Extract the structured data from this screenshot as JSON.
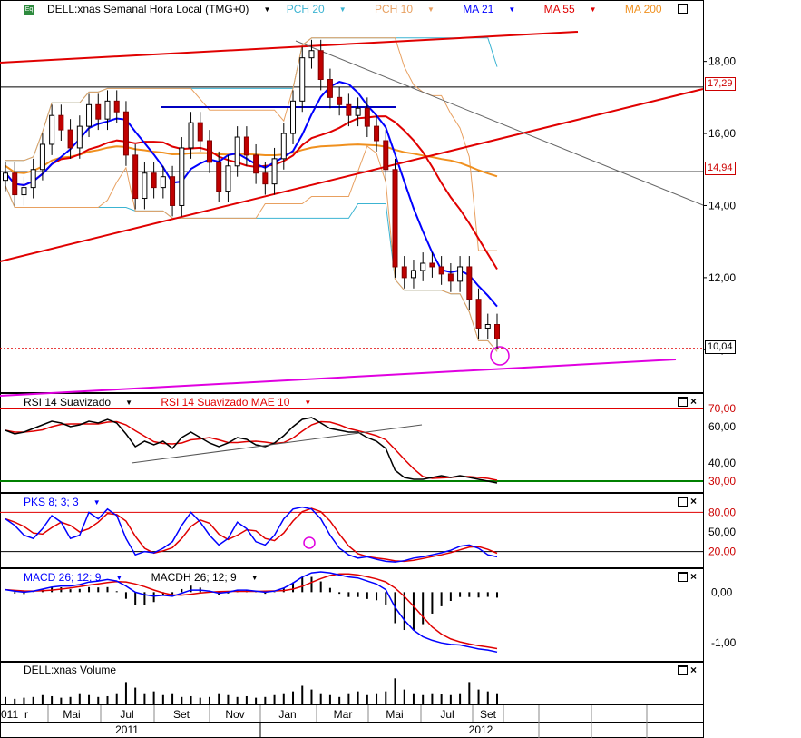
{
  "panels": {
    "price": {
      "title": "DELL:xnas Semanal Hora Local (TMG+0)",
      "indicators": [
        {
          "label": "PCH 20",
          "color": "#3cb4d2"
        },
        {
          "label": "PCH 10",
          "color": "#e8a060"
        },
        {
          "label": "MA 21",
          "color": "#0000ff"
        },
        {
          "label": "MA 55",
          "color": "#e00000"
        },
        {
          "label": "MA 200",
          "color": "#f0901e"
        }
      ]
    },
    "rsi": {
      "labels": [
        {
          "label": "RSI 14 Suavizado",
          "color": "#000000"
        },
        {
          "label": "RSI 14 Suavizado MAE 10",
          "color": "#e00000"
        }
      ]
    },
    "pks": {
      "labels": [
        {
          "label": "PKS 8; 3; 3",
          "color": "#0000ff"
        }
      ]
    },
    "macd": {
      "labels": [
        {
          "label": "MACD 26; 12; 9",
          "color": "#0000ff"
        },
        {
          "label": "MACDH 26; 12; 9",
          "color": "#000000"
        }
      ]
    },
    "volume": {
      "labels": [
        {
          "label": "DELL:xnas Volume",
          "color": "#000000"
        }
      ]
    }
  },
  "icons": {
    "eq": "Eq"
  },
  "x_axis": {
    "months": [
      "r",
      "Mai",
      "Jul",
      "Set",
      "Nov",
      "Jan",
      "Mar",
      "Mai",
      "Jul",
      "Set"
    ],
    "years": [
      "2011",
      "2012"
    ],
    "first_year_stub": "011"
  },
  "price_axis": {
    "ticks": [
      "18,00",
      "16,00",
      "14,00",
      "12,00",
      "10,00"
    ]
  },
  "price_tags": {
    "upper": "17,29",
    "middle": "14,94",
    "current": "10,04"
  },
  "rsi_axis": {
    "ticks": [
      "70,00",
      "60,00",
      "40,00",
      "30,00"
    ]
  },
  "pks_axis": {
    "ticks": [
      "80,00",
      "50,00",
      "20,00"
    ]
  },
  "macd_axis": {
    "ticks": [
      "0,00",
      "-1,00"
    ]
  },
  "chart_data": {
    "type": "candlestick",
    "ylim": [
      9.0,
      19.2
    ],
    "close": [
      14.9,
      14.3,
      14.5,
      15.0,
      15.7,
      16.5,
      16.1,
      15.6,
      16.2,
      16.8,
      16.4,
      16.9,
      16.6,
      15.4,
      14.2,
      14.9,
      14.5,
      14.8,
      14.0,
      15.6,
      16.3,
      15.8,
      15.2,
      14.4,
      15.1,
      15.9,
      15.4,
      14.9,
      14.6,
      15.3,
      16.0,
      16.9,
      18.1,
      18.3,
      17.5,
      17.0,
      16.8,
      16.5,
      16.7,
      16.2,
      15.8,
      15.0,
      12.3,
      12.0,
      12.2,
      12.4,
      12.3,
      12.1,
      11.9,
      12.3,
      11.4,
      10.6,
      10.7,
      10.3
    ],
    "levels": {
      "upper": 17.29,
      "middle": 14.94,
      "current": 10.04
    },
    "rsi": {
      "ylim": [
        25,
        75
      ],
      "levels": [
        70,
        30
      ],
      "rsi": [
        58,
        56,
        57,
        59,
        61,
        63,
        62,
        60,
        61,
        63,
        62,
        64,
        62,
        56,
        49,
        52,
        50,
        52,
        48,
        54,
        57,
        54,
        51,
        49,
        51,
        54,
        53,
        50,
        49,
        51,
        55,
        60,
        64,
        65,
        62,
        59,
        58,
        57,
        57,
        54,
        52,
        48,
        36,
        32,
        31,
        31,
        32,
        33,
        32,
        33,
        32,
        31,
        30,
        29
      ]
    },
    "pks": {
      "ylim": [
        0,
        100
      ],
      "levels": [
        80,
        20
      ],
      "k": [
        70,
        60,
        45,
        40,
        55,
        75,
        65,
        40,
        45,
        80,
        70,
        85,
        75,
        40,
        15,
        20,
        18,
        25,
        35,
        60,
        80,
        65,
        45,
        30,
        40,
        65,
        55,
        35,
        30,
        45,
        70,
        85,
        88,
        85,
        70,
        45,
        25,
        15,
        10,
        12,
        8,
        5,
        4,
        6,
        10,
        12,
        15,
        18,
        22,
        28,
        30,
        25,
        15,
        12
      ]
    },
    "macd": {
      "ylim": [
        -1.3,
        0.4
      ],
      "macd": [
        0.05,
        0.02,
        0.0,
        0.02,
        0.06,
        0.1,
        0.12,
        0.12,
        0.15,
        0.2,
        0.22,
        0.25,
        0.22,
        0.12,
        0.0,
        -0.05,
        -0.08,
        -0.06,
        -0.08,
        -0.02,
        0.04,
        0.04,
        0.02,
        -0.02,
        0.0,
        0.04,
        0.04,
        0.02,
        0.0,
        0.02,
        0.08,
        0.18,
        0.3,
        0.38,
        0.4,
        0.38,
        0.34,
        0.3,
        0.28,
        0.22,
        0.16,
        0.05,
        -0.3,
        -0.55,
        -0.75,
        -0.88,
        -0.95,
        -1.0,
        -1.03,
        -1.04,
        -1.08,
        -1.12,
        -1.14,
        -1.18
      ]
    },
    "volume": [
      0.2,
      0.15,
      0.18,
      0.2,
      0.25,
      0.22,
      0.18,
      0.2,
      0.3,
      0.25,
      0.2,
      0.22,
      0.3,
      0.6,
      0.45,
      0.3,
      0.35,
      0.25,
      0.3,
      0.2,
      0.22,
      0.18,
      0.2,
      0.3,
      0.25,
      0.2,
      0.22,
      0.18,
      0.2,
      0.25,
      0.3,
      0.35,
      0.5,
      0.4,
      0.3,
      0.25,
      0.2,
      0.3,
      0.35,
      0.25,
      0.3,
      0.35,
      0.7,
      0.4,
      0.3,
      0.25,
      0.3,
      0.28,
      0.25,
      0.3,
      0.6,
      0.4,
      0.35,
      0.3
    ]
  }
}
